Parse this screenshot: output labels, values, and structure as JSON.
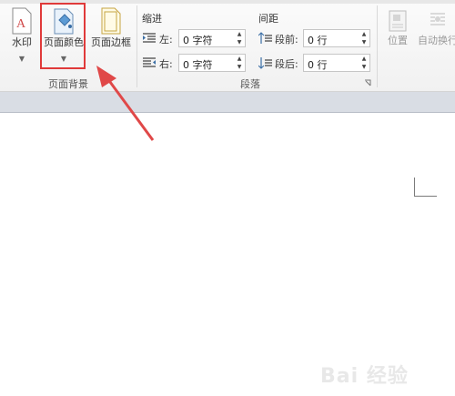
{
  "ribbon": {
    "watermark_btn": "水印",
    "page_color_btn": "页面颜色",
    "page_border_btn": "页面边框",
    "page_bg_group": "页面背景",
    "indent_head": "缩进",
    "spacing_head": "间距",
    "left_label": "左:",
    "right_label": "右:",
    "left_value": "0 字符",
    "right_value": "0 字符",
    "before_label": "段前:",
    "after_label": "段后:",
    "before_value": "0 行",
    "after_value": "0 行",
    "paragraph_group": "段落",
    "position_btn": "位置",
    "wrap_btn": "自动换行"
  },
  "watermark": "Bai 经验",
  "colors": {
    "highlight": "#e03a3a",
    "arrow": "#e04848"
  }
}
